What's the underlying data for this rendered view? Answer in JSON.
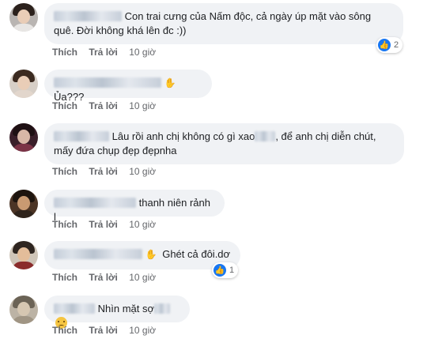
{
  "comments": [
    {
      "text_line1": "Con trai cưng của Nấm độc, cả ngày úp mặt vào sông",
      "text_line2": "quê. Đời không khá lên đc :))",
      "reaction_count": "2"
    },
    {
      "text": "Ủa???"
    },
    {
      "text_line1": "Lâu rồi anh chị không có gì xao",
      "text_line1b": ", để anh chị diễn chút,",
      "text_line2": "mấy đứa chụp đẹp đẹpnha"
    },
    {
      "text": "thanh niên rảnh l"
    },
    {
      "text": "Ghét cả đôi.dơ",
      "reaction_count": "1"
    },
    {
      "text": "Nhìn mặt sợ"
    }
  ],
  "actions": {
    "like": "Thích",
    "reply": "Trả lời",
    "time": "10 giờ"
  },
  "icons": {
    "reaction": "like-icon",
    "hand": "waving-hand-icon",
    "emoji": "face-emoji-icon"
  },
  "colors": {
    "bubble": "#f0f2f5",
    "like_blue": "#1877f2",
    "meta": "#65676b"
  }
}
